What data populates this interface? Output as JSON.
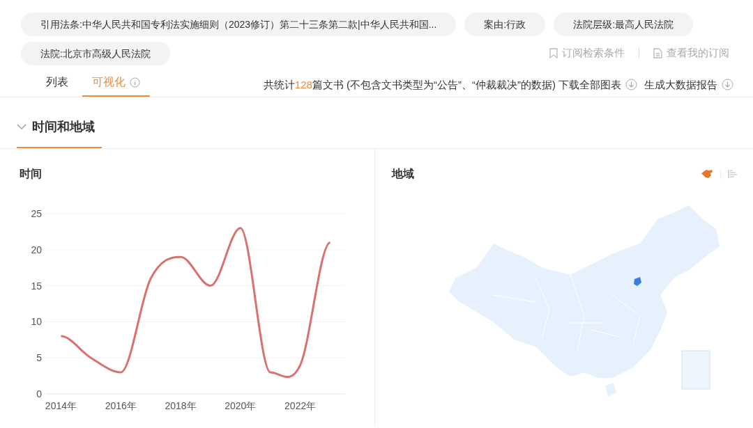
{
  "filters": [
    {
      "label": "引用法条:中华人民共和国专利法实施细则（2023修订）第二十三条第二款|中华人民共和国..."
    },
    {
      "label": "案由:行政"
    },
    {
      "label": "法院层级:最高人民法院"
    },
    {
      "label": "法院:北京市高级人民法院"
    }
  ],
  "subscribe_links": [
    "订阅检索条件",
    "查看我的订阅"
  ],
  "tabs": [
    {
      "label": "列表",
      "selected": false
    },
    {
      "label": "可视化",
      "selected": true
    }
  ],
  "summary": {
    "prefix": "共统计",
    "count": "128",
    "suffix": "篇文书 (不包含文书类型为“公告”、“仲裁裁决”的数据)"
  },
  "actions": [
    "下载全部图表",
    "生成大数据报告"
  ],
  "section": {
    "title": "时间和地域",
    "expanded": true
  },
  "time_panel": {
    "title": "时间",
    "chart_data": {
      "type": "line",
      "x": [
        2014,
        2015,
        2016,
        2017,
        2018,
        2019,
        2020,
        2021,
        2022,
        2023
      ],
      "series": [
        {
          "color": "#d9716f",
          "values": [
            8,
            5,
            3,
            16,
            19,
            15,
            23,
            3,
            4,
            21
          ]
        }
      ],
      "xlim": [
        2013.5,
        2023.5
      ],
      "ylim": [
        0,
        25
      ],
      "grid": true,
      "yticks": [
        0,
        5,
        10,
        15,
        20,
        25
      ],
      "xticks": [
        {
          "value": 2014,
          "label": "2014年"
        },
        {
          "value": 2016,
          "label": "2016年"
        },
        {
          "value": 2018,
          "label": "2018年"
        },
        {
          "value": 2020,
          "label": "2020年"
        },
        {
          "value": 2022,
          "label": "2022年"
        }
      ]
    }
  },
  "region_panel": {
    "title": "地域",
    "view_buttons": [
      {
        "kind": "map",
        "selected": true
      },
      {
        "kind": "list",
        "selected": false
      }
    ]
  }
}
